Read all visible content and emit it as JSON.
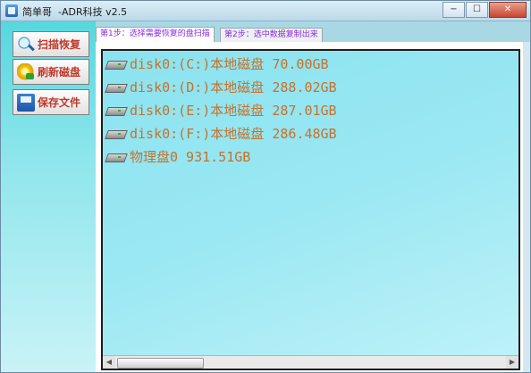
{
  "window": {
    "title_main": "简单哥",
    "title_sub": "-ADR科技 v2.5",
    "minimize_glyph": "−",
    "maximize_glyph": "☐",
    "close_glyph": "✕"
  },
  "sidebar": {
    "items": [
      {
        "label": "扫描恢复",
        "icon": "magnifier-icon"
      },
      {
        "label": "刷新磁盘",
        "icon": "refresh-icon"
      },
      {
        "label": "保存文件",
        "icon": "save-icon"
      }
    ]
  },
  "tabs": [
    {
      "label": "第1步：选择需要恢复的盘扫描",
      "active": true
    },
    {
      "label": "第2步：选中数据复制出来",
      "active": false
    }
  ],
  "disks": [
    {
      "label": "disk0:(C:)本地磁盘 70.00GB"
    },
    {
      "label": "disk0:(D:)本地磁盘 288.02GB"
    },
    {
      "label": "disk0:(E:)本地磁盘 287.01GB"
    },
    {
      "label": "disk0:(F:)本地磁盘 286.48GB"
    },
    {
      "label": "物理盘0 931.51GB"
    }
  ],
  "scrollbar": {
    "left_glyph": "◀",
    "right_glyph": "▶"
  },
  "colors": {
    "disk_text": "#c8712a",
    "tab_text": "#8a2be2",
    "sidebar_label": "#c0392b"
  }
}
